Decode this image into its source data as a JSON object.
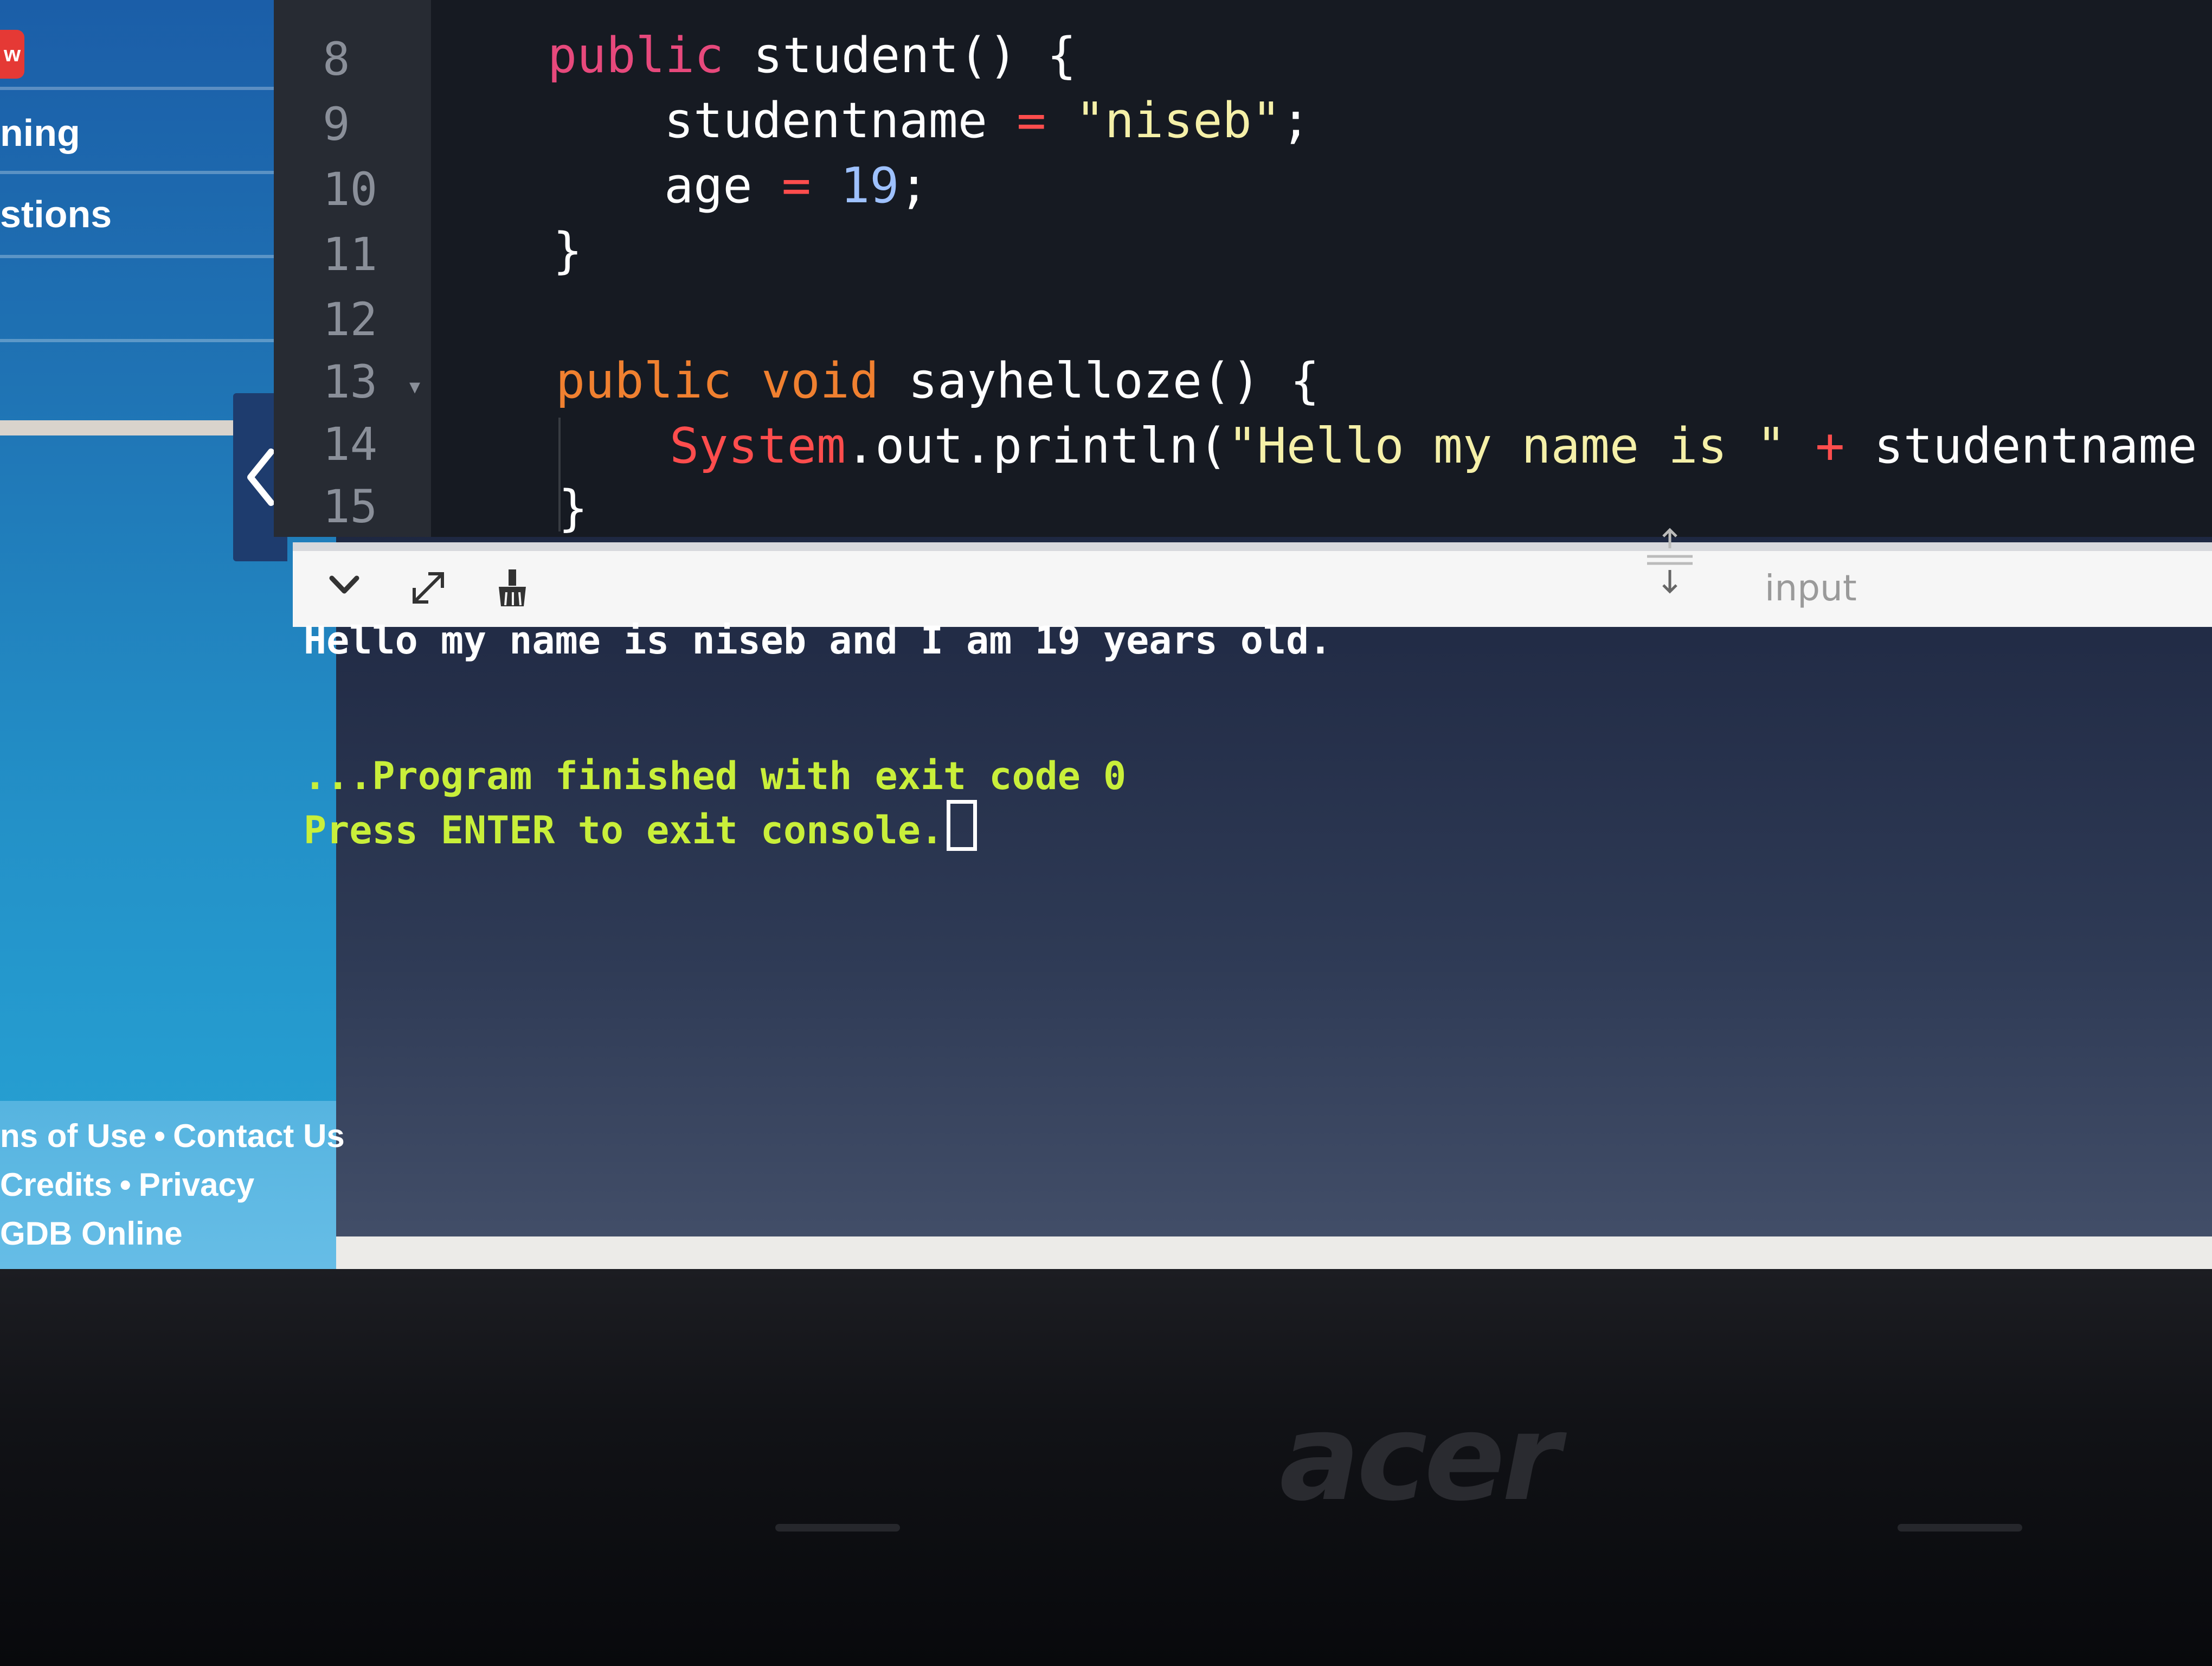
{
  "sidebar": {
    "badge": "w",
    "items": [
      {
        "label": "ning"
      },
      {
        "label": "stions"
      }
    ],
    "footer": {
      "line1": [
        "ns of Use",
        "Contact Us"
      ],
      "line2": [
        "Credits",
        "Privacy"
      ],
      "line3": "GDB Online",
      "separator": "•"
    }
  },
  "editor": {
    "line_numbers": [
      "8",
      "9",
      "10",
      "11",
      "12",
      "13",
      "14",
      "15"
    ],
    "lines": {
      "l8": {
        "kw": "public",
        "rest": " student() {"
      },
      "l9": {
        "ident": "studentname",
        "eq": " = ",
        "str": "\"niseb\"",
        "end": ";"
      },
      "l10": {
        "ident": "age",
        "eq": " = ",
        "num": "19",
        "end": ";"
      },
      "l11": {
        "text": "}"
      },
      "l13": {
        "kw1": "public",
        "kw2": " void",
        "rest": " sayhelloze() {"
      },
      "l14": {
        "sys": "System",
        "rest": ".out.println(",
        "str": "\"Hello my name is \"",
        "plus": " + ",
        "ident": "studentname",
        "plus2": " + ",
        "str2": "\""
      },
      "l15": {
        "text": "}"
      }
    }
  },
  "console_toolbar": {
    "input_label": "input"
  },
  "console": {
    "output_line": "Hello my name is niseb and I am 19 years old.",
    "finished_line": "...Program finished with exit code 0",
    "press_line": "Press ENTER to exit console."
  },
  "laptop": {
    "brand": "acer"
  }
}
